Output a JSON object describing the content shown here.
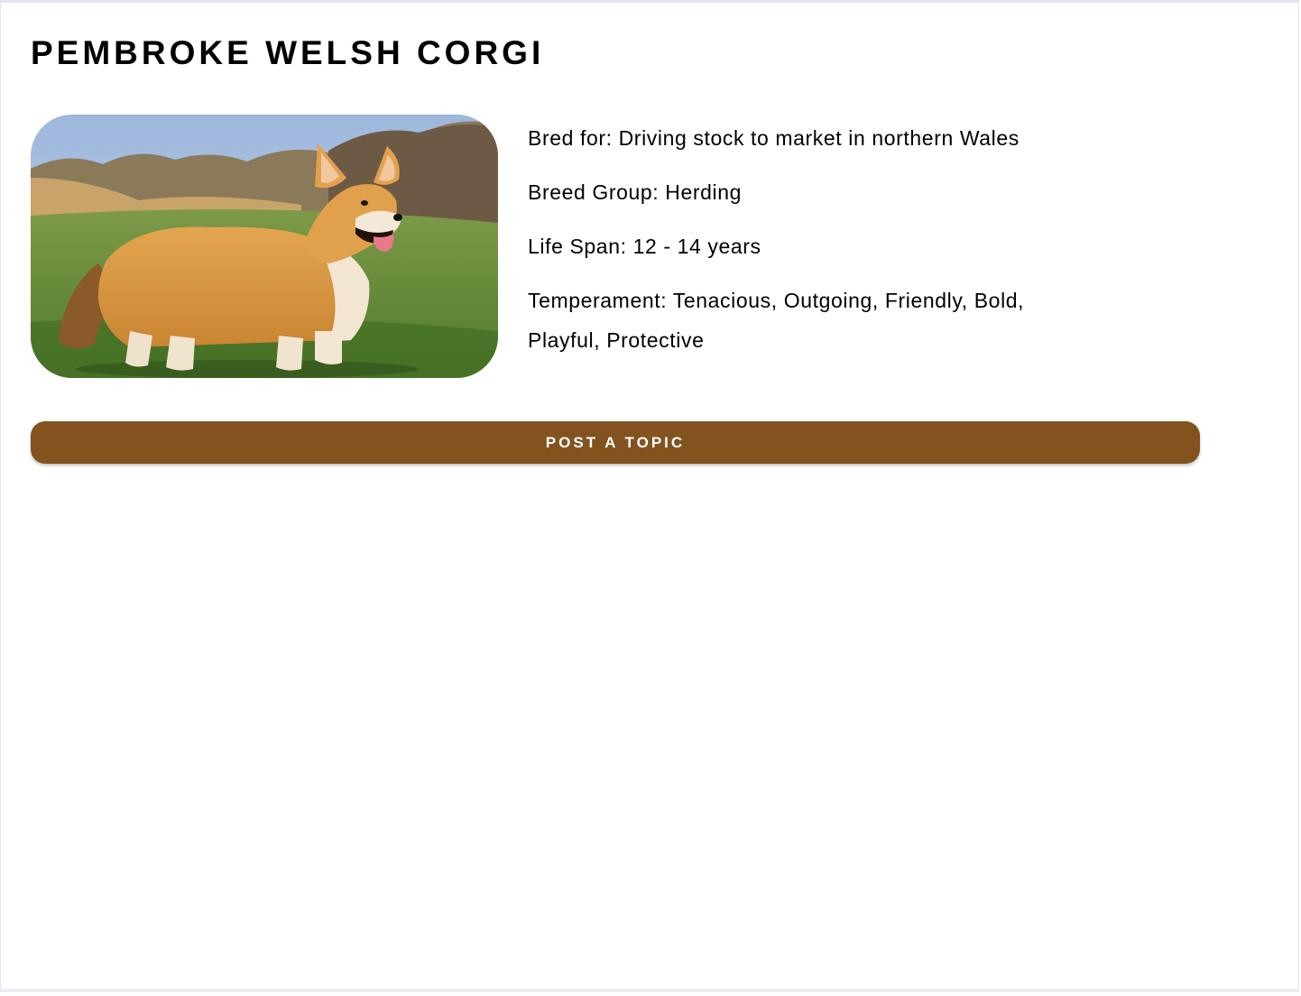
{
  "breed": {
    "name": "PEMBROKE WELSH CORGI",
    "image_alt": "Pembroke Welsh Corgi standing on grass"
  },
  "details": {
    "bred_for": "Bred for: Driving stock to market in northern Wales",
    "breed_group": "Breed Group: Herding",
    "life_span": "Life Span: 12 - 14 years",
    "temperament_line1": "Temperament: Tenacious, Outgoing, Friendly, Bold,",
    "temperament_line2": "Playful, Protective"
  },
  "actions": {
    "post_topic_label": "POST A TOPIC"
  },
  "colors": {
    "button_bg": "#82531f",
    "button_text": "#ffffff"
  }
}
